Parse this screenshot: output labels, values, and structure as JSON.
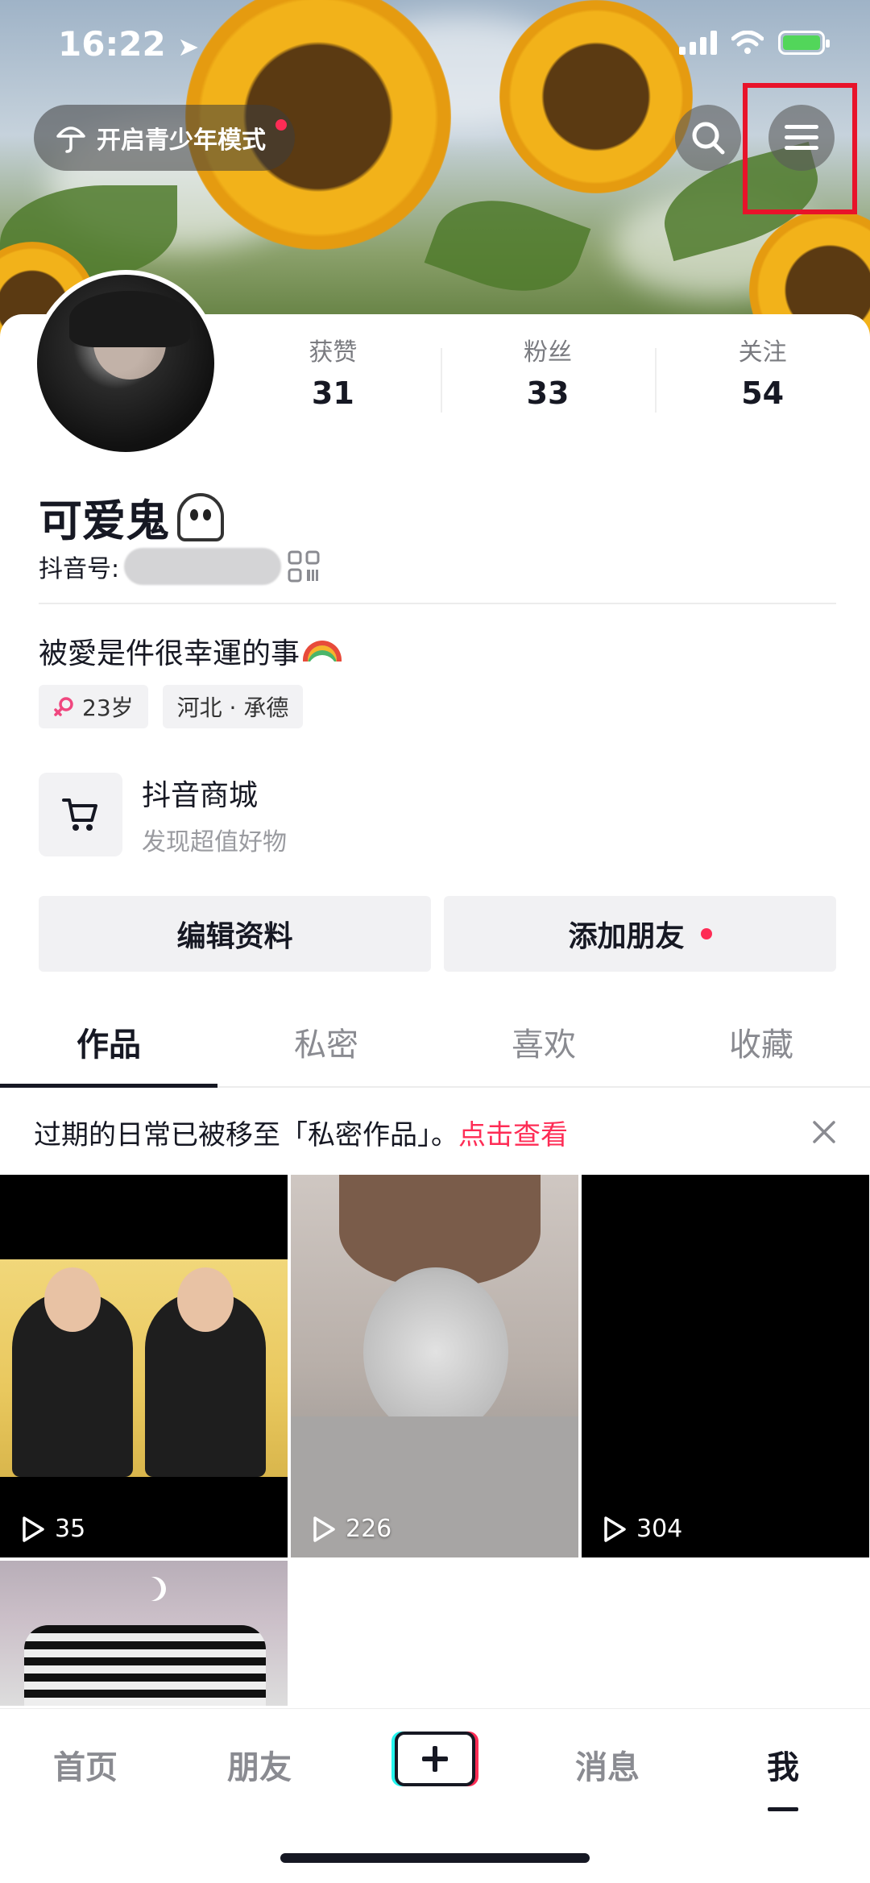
{
  "status_bar": {
    "time": "16:22"
  },
  "header": {
    "teen_mode_label": "开启青少年模式"
  },
  "profile": {
    "nickname": "可爱鬼",
    "douyin_id_label": "抖音号:",
    "bio": "被愛是件很幸運的事",
    "stats": [
      {
        "label": "获赞",
        "value": "31"
      },
      {
        "label": "粉丝",
        "value": "33"
      },
      {
        "label": "关注",
        "value": "54"
      }
    ],
    "tags": {
      "age": "23岁",
      "location": "河北 · 承德"
    }
  },
  "mall": {
    "title": "抖音商城",
    "subtitle": "发现超值好物"
  },
  "actions": {
    "edit_label": "编辑资料",
    "add_friend_label": "添加朋友"
  },
  "tabs": [
    {
      "label": "作品",
      "active": true
    },
    {
      "label": "私密",
      "active": false
    },
    {
      "label": "喜欢",
      "active": false
    },
    {
      "label": "收藏",
      "active": false
    }
  ],
  "notice": {
    "text": "过期的日常已被移至「私密作品」。",
    "link": "点击查看"
  },
  "videos": [
    {
      "plays": "35"
    },
    {
      "plays": "226"
    },
    {
      "plays": "304"
    },
    {
      "plays": ""
    }
  ],
  "bottom_nav": [
    {
      "label": "首页"
    },
    {
      "label": "朋友"
    },
    {
      "label": "消息"
    },
    {
      "label": "我",
      "active": true
    }
  ],
  "colors": {
    "accent": "#fe2c55",
    "highlight_box": "#e8132a",
    "text": "#161823"
  }
}
